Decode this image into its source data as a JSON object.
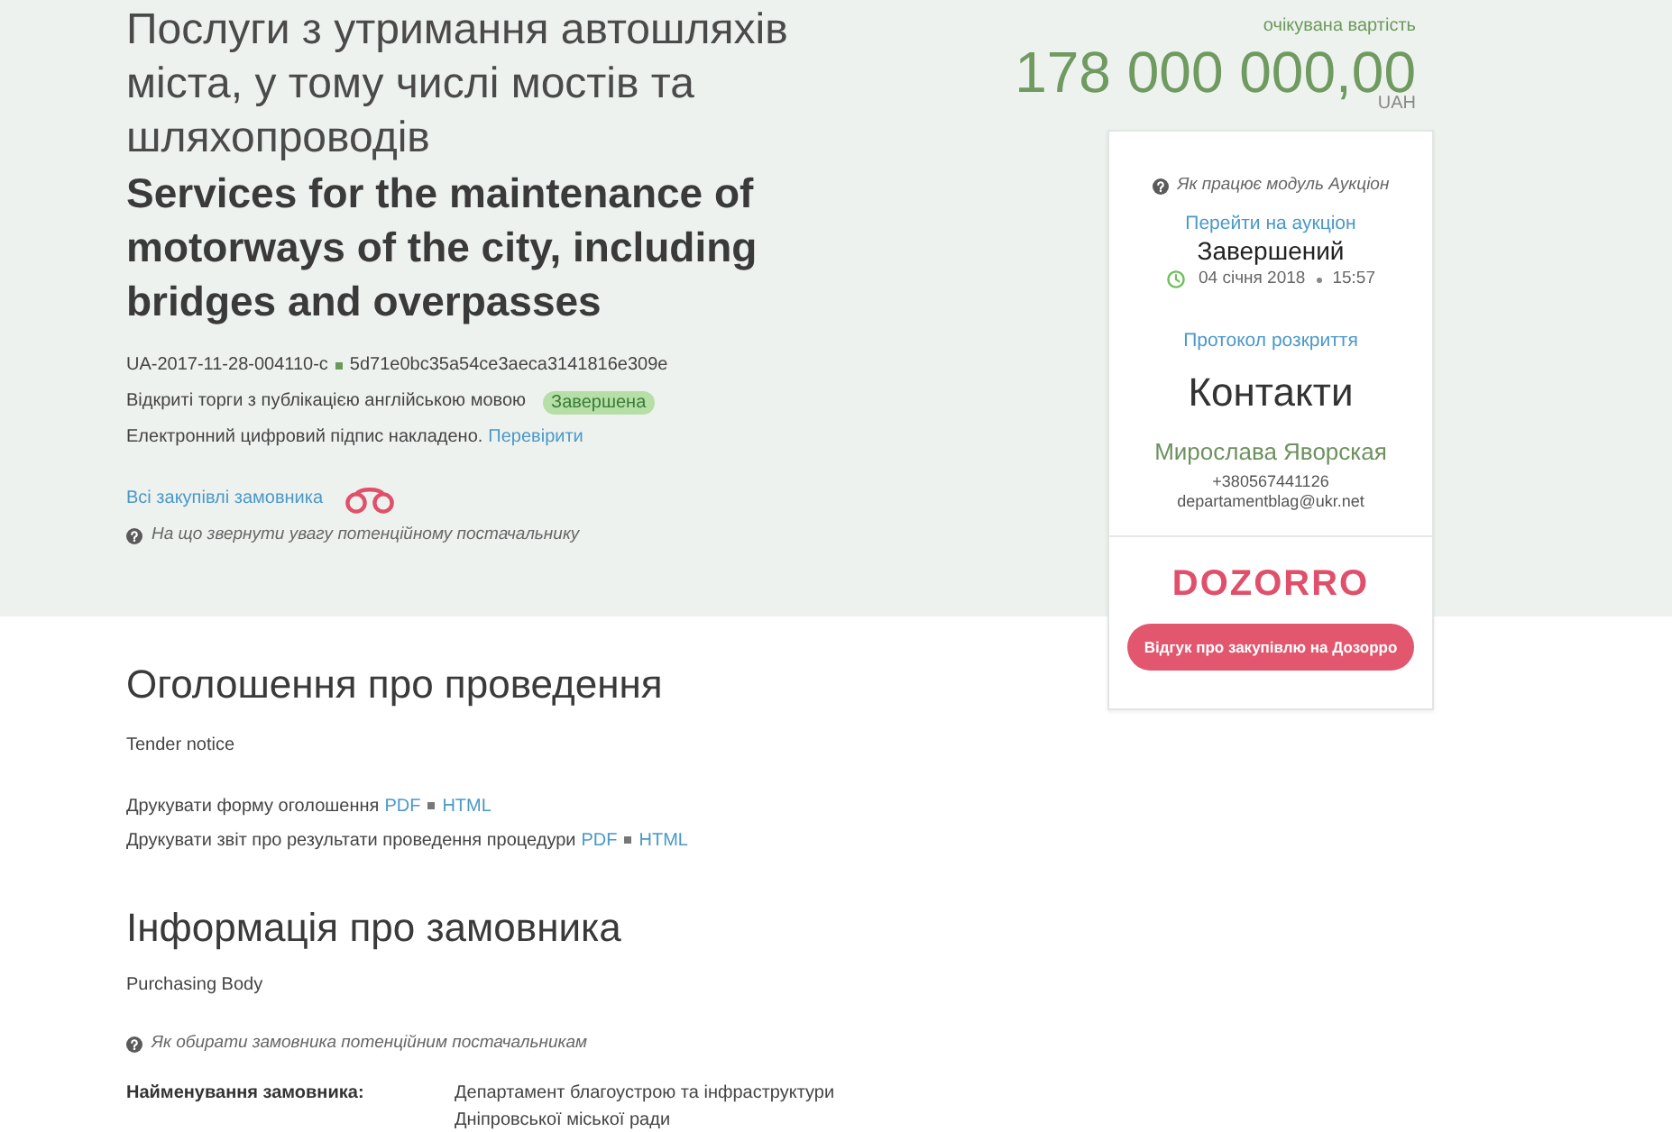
{
  "header": {
    "title": "Послуги з утримання автошляхів міста, у тому числі мостів та шляхопроводів",
    "title_en": "Services for the maintenance of motorways of the city, including bridges and overpasses",
    "tender_id": "UA-2017-11-28-004110-c",
    "hash": "5d71e0bc35a54ce3aeca3141816e309e",
    "procedure": "Відкриті торги з публікацією англійською мовою",
    "status_badge": "Завершена",
    "signature_text": "Електронний цифровий підпис накладено.",
    "verify_link": "Перевірити",
    "all_purchases_link": "Всі закупівлі замовника",
    "hint": "На що звернути увагу потенційному постачальнику"
  },
  "price": {
    "label": "очікувана вартість",
    "amount": "178 000 000,00",
    "currency": "UAH"
  },
  "card": {
    "hint": "Як працює модуль Аукціон",
    "auction_link": "Перейти на аукціон",
    "auction_status": "Завершений",
    "date": "04 січня 2018",
    "time": "15:57",
    "protocol_link": "Протокол розкриття",
    "contacts_heading": "Контакти",
    "contact_name": "Мирослава Яворская",
    "phone": "+380567441126",
    "email": "departamentblag@ukr.net",
    "logo": "DOZORRO",
    "review_button": "Відгук про закупівлю на Дозорро"
  },
  "notice": {
    "heading": "Оголошення про проведення",
    "subtitle": "Tender notice",
    "print_lines": [
      {
        "text": "Друкувати форму оголошення",
        "links": [
          "PDF",
          "HTML"
        ]
      },
      {
        "text": "Друкувати звіт про результати проведення процедури",
        "links": [
          "PDF",
          "HTML"
        ]
      }
    ]
  },
  "buyer": {
    "heading": "Інформація про замовника",
    "subtitle": "Purchasing Body",
    "hint": "Як обирати замовника потенційним постачальникам",
    "fields": [
      {
        "label": "Найменування замовника:",
        "value": "Департамент благоустрою та інфраструктури Дніпровської міської ради"
      }
    ]
  }
}
